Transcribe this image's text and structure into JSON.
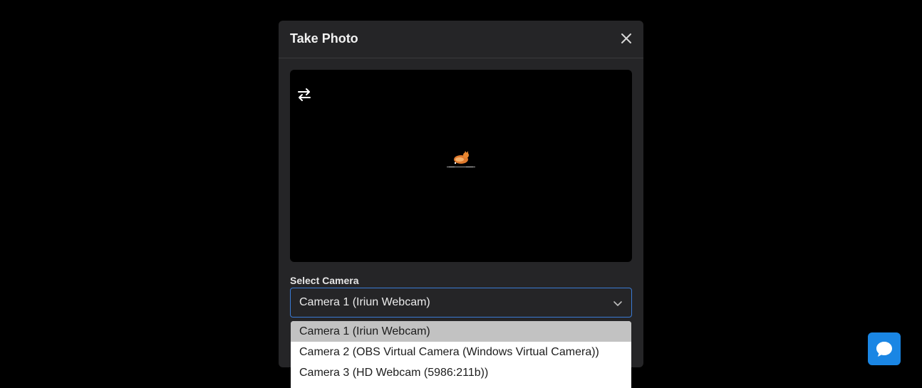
{
  "modal": {
    "title": "Take Photo"
  },
  "camera": {
    "label": "Select Camera",
    "selected": "Camera 1 (Iriun Webcam)",
    "options": [
      "Camera 1 (Iriun Webcam)",
      "Camera 2 (OBS Virtual Camera (Windows Virtual Camera))",
      "Camera 3 (HD Webcam (5986:211b))"
    ]
  },
  "icons": {
    "close": "close-icon",
    "switch_camera": "switch-camera-icon",
    "chevron": "chevron-down-icon",
    "chat": "chat-icon",
    "preview_logo": "iriun-logo-icon"
  },
  "colors": {
    "modal_bg": "#252527",
    "accent": "#3a7bd5",
    "chat_button": "#1a86e4",
    "dropdown_selected": "#c2c2c2"
  }
}
